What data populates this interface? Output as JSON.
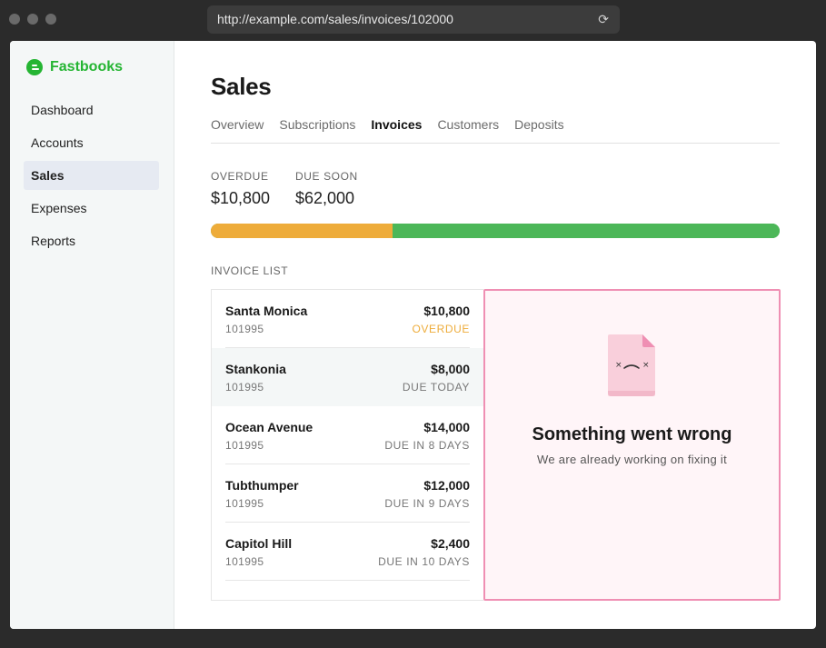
{
  "browser": {
    "url": "http://example.com/sales/invoices/102000",
    "reload_icon": "⟳"
  },
  "sidebar": {
    "brand": "Fastbooks",
    "brand_color": "#25b533",
    "items": [
      {
        "label": "Dashboard",
        "active": false
      },
      {
        "label": "Accounts",
        "active": false
      },
      {
        "label": "Sales",
        "active": true
      },
      {
        "label": "Expenses",
        "active": false
      },
      {
        "label": "Reports",
        "active": false
      }
    ]
  },
  "page": {
    "title": "Sales",
    "tabs": [
      {
        "label": "Overview",
        "active": false
      },
      {
        "label": "Subscriptions",
        "active": false
      },
      {
        "label": "Invoices",
        "active": true
      },
      {
        "label": "Customers",
        "active": false
      },
      {
        "label": "Deposits",
        "active": false
      }
    ]
  },
  "summary": {
    "overdue_label": "OVERDUE",
    "overdue_value": "$10,800",
    "due_soon_label": "DUE SOON",
    "due_soon_value": "$62,000",
    "overdue_fraction": 0.32,
    "overdue_color": "#eeac3a",
    "due_soon_color": "#4cb758"
  },
  "invoices": {
    "label": "INVOICE LIST",
    "rows": [
      {
        "customer": "Santa Monica",
        "number": "101995",
        "amount": "$10,800",
        "due": "OVERDUE"
      },
      {
        "customer": "Stankonia",
        "number": "101995",
        "amount": "$8,000",
        "due": "DUE TODAY"
      },
      {
        "customer": "Ocean Avenue",
        "number": "101995",
        "amount": "$14,000",
        "due": "DUE IN 8 DAYS"
      },
      {
        "customer": "Tubthumper",
        "number": "101995",
        "amount": "$12,000",
        "due": "DUE IN 9 DAYS"
      },
      {
        "customer": "Capitol Hill",
        "number": "101995",
        "amount": "$2,400",
        "due": "DUE IN 10 DAYS"
      }
    ]
  },
  "error": {
    "icon": "sad-document-icon",
    "title": "Something went wrong",
    "subtitle": "We are already working on fixing it",
    "border_color": "#ef8fb3"
  }
}
